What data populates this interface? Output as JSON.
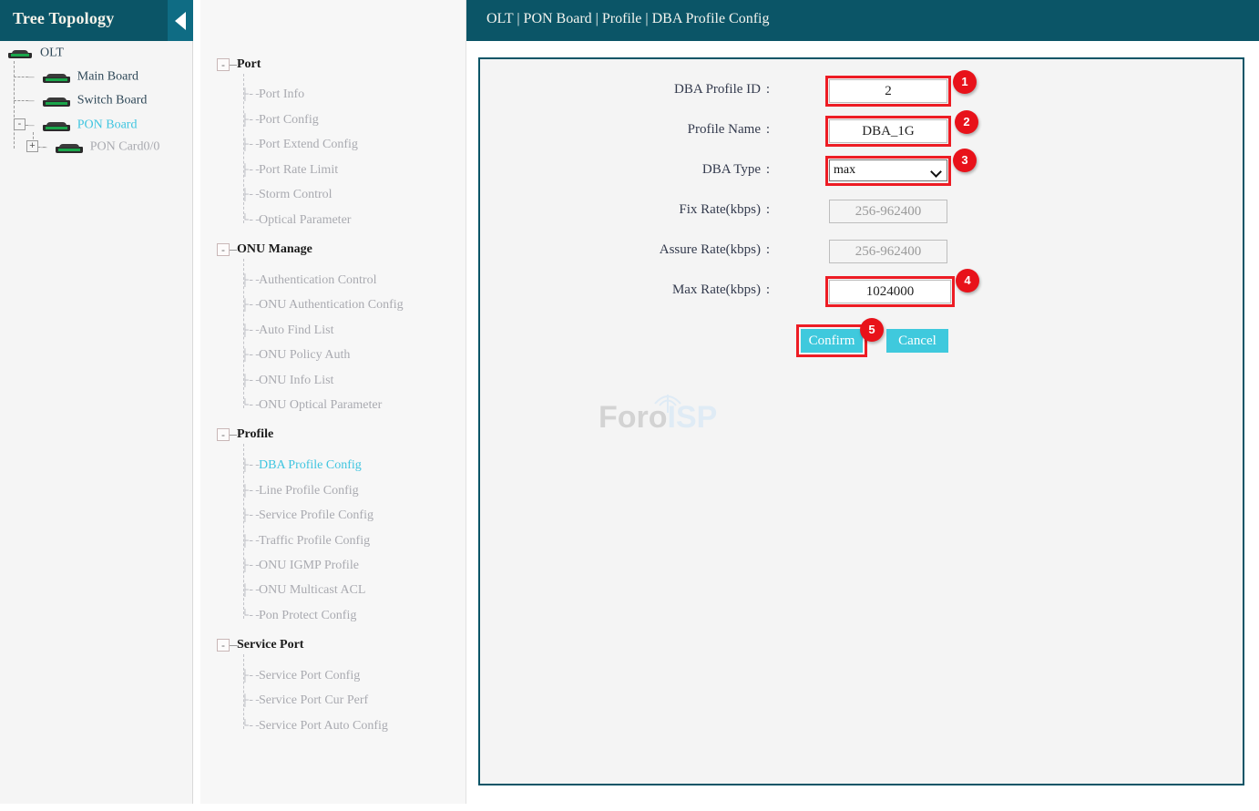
{
  "tree_panel": {
    "title": "Tree Topology",
    "collapse_icon": "triangle-left-icon",
    "nodes": [
      {
        "label": "OLT",
        "icon": "device-icon",
        "state": "normal",
        "toggle": null
      },
      {
        "label": "Main Board",
        "icon": "board-icon",
        "state": "normal",
        "toggle": null
      },
      {
        "label": "Switch Board",
        "icon": "board-icon",
        "state": "normal",
        "toggle": null
      },
      {
        "label": "PON Board",
        "icon": "board-icon",
        "state": "active",
        "toggle": "-"
      },
      {
        "label": "PON Card0/0",
        "icon": "board-icon",
        "state": "disabled",
        "toggle": "+"
      }
    ]
  },
  "menu": {
    "groups": [
      {
        "label": "Port",
        "toggle": "-",
        "items": [
          {
            "label": "Port Info",
            "active": false
          },
          {
            "label": "Port Config",
            "active": false
          },
          {
            "label": "Port Extend Config",
            "active": false
          },
          {
            "label": "Port Rate Limit",
            "active": false
          },
          {
            "label": "Storm Control",
            "active": false
          },
          {
            "label": "Optical Parameter",
            "active": false
          }
        ]
      },
      {
        "label": "ONU Manage",
        "toggle": "-",
        "items": [
          {
            "label": "Authentication Control",
            "active": false
          },
          {
            "label": "ONU Authentication Config",
            "active": false
          },
          {
            "label": "Auto Find List",
            "active": false
          },
          {
            "label": "ONU Policy Auth",
            "active": false
          },
          {
            "label": "ONU Info List",
            "active": false
          },
          {
            "label": "ONU Optical Parameter",
            "active": false
          }
        ]
      },
      {
        "label": "Profile",
        "toggle": "-",
        "items": [
          {
            "label": "DBA Profile Config",
            "active": true
          },
          {
            "label": "Line Profile Config",
            "active": false
          },
          {
            "label": "Service Profile Config",
            "active": false
          },
          {
            "label": "Traffic Profile Config",
            "active": false
          },
          {
            "label": "ONU IGMP Profile",
            "active": false
          },
          {
            "label": "ONU Multicast ACL",
            "active": false
          },
          {
            "label": "Pon Protect Config",
            "active": false
          }
        ]
      },
      {
        "label": "Service Port",
        "toggle": "-",
        "items": [
          {
            "label": "Service Port Config",
            "active": false
          },
          {
            "label": "Service Port Cur Perf",
            "active": false
          },
          {
            "label": "Service Port Auto Config",
            "active": false
          }
        ]
      }
    ]
  },
  "header": {
    "breadcrumb": "OLT | PON Board | Profile | DBA Profile Config"
  },
  "form": {
    "fields": [
      {
        "label": "DBA Profile ID",
        "value": "2",
        "placeholder": "",
        "type": "text",
        "disabled": false,
        "highlighted": true
      },
      {
        "label": "Profile Name",
        "value": "DBA_1G",
        "placeholder": "",
        "type": "text",
        "disabled": false,
        "highlighted": true
      },
      {
        "label": "DBA Type",
        "value": "max",
        "placeholder": "",
        "type": "select",
        "disabled": false,
        "highlighted": true
      },
      {
        "label": "Fix Rate(kbps)",
        "value": "",
        "placeholder": "256-962400",
        "type": "text",
        "disabled": true,
        "highlighted": false
      },
      {
        "label": "Assure Rate(kbps)",
        "value": "",
        "placeholder": "256-962400",
        "type": "text",
        "disabled": true,
        "highlighted": false
      },
      {
        "label": "Max Rate(kbps)",
        "value": "1024000",
        "placeholder": "",
        "type": "text",
        "disabled": false,
        "highlighted": true
      }
    ],
    "separator": ":",
    "select_options": [
      "max"
    ],
    "buttons": {
      "confirm": "Confirm",
      "cancel": "Cancel"
    }
  },
  "annotations": {
    "badges": [
      "1",
      "2",
      "3",
      "4",
      "5"
    ]
  },
  "watermark": {
    "text_primary": "Foro",
    "text_secondary": "ISP",
    "icon": "antenna-signal-icon"
  },
  "colors": {
    "header_teal": "#0b5567",
    "accent_cyan": "#3fc9dd",
    "annotation_red": "#ed1c24",
    "badge_red": "#e8121a",
    "active_link": "#3fc5e0",
    "menu_text": "#a9aab0"
  }
}
